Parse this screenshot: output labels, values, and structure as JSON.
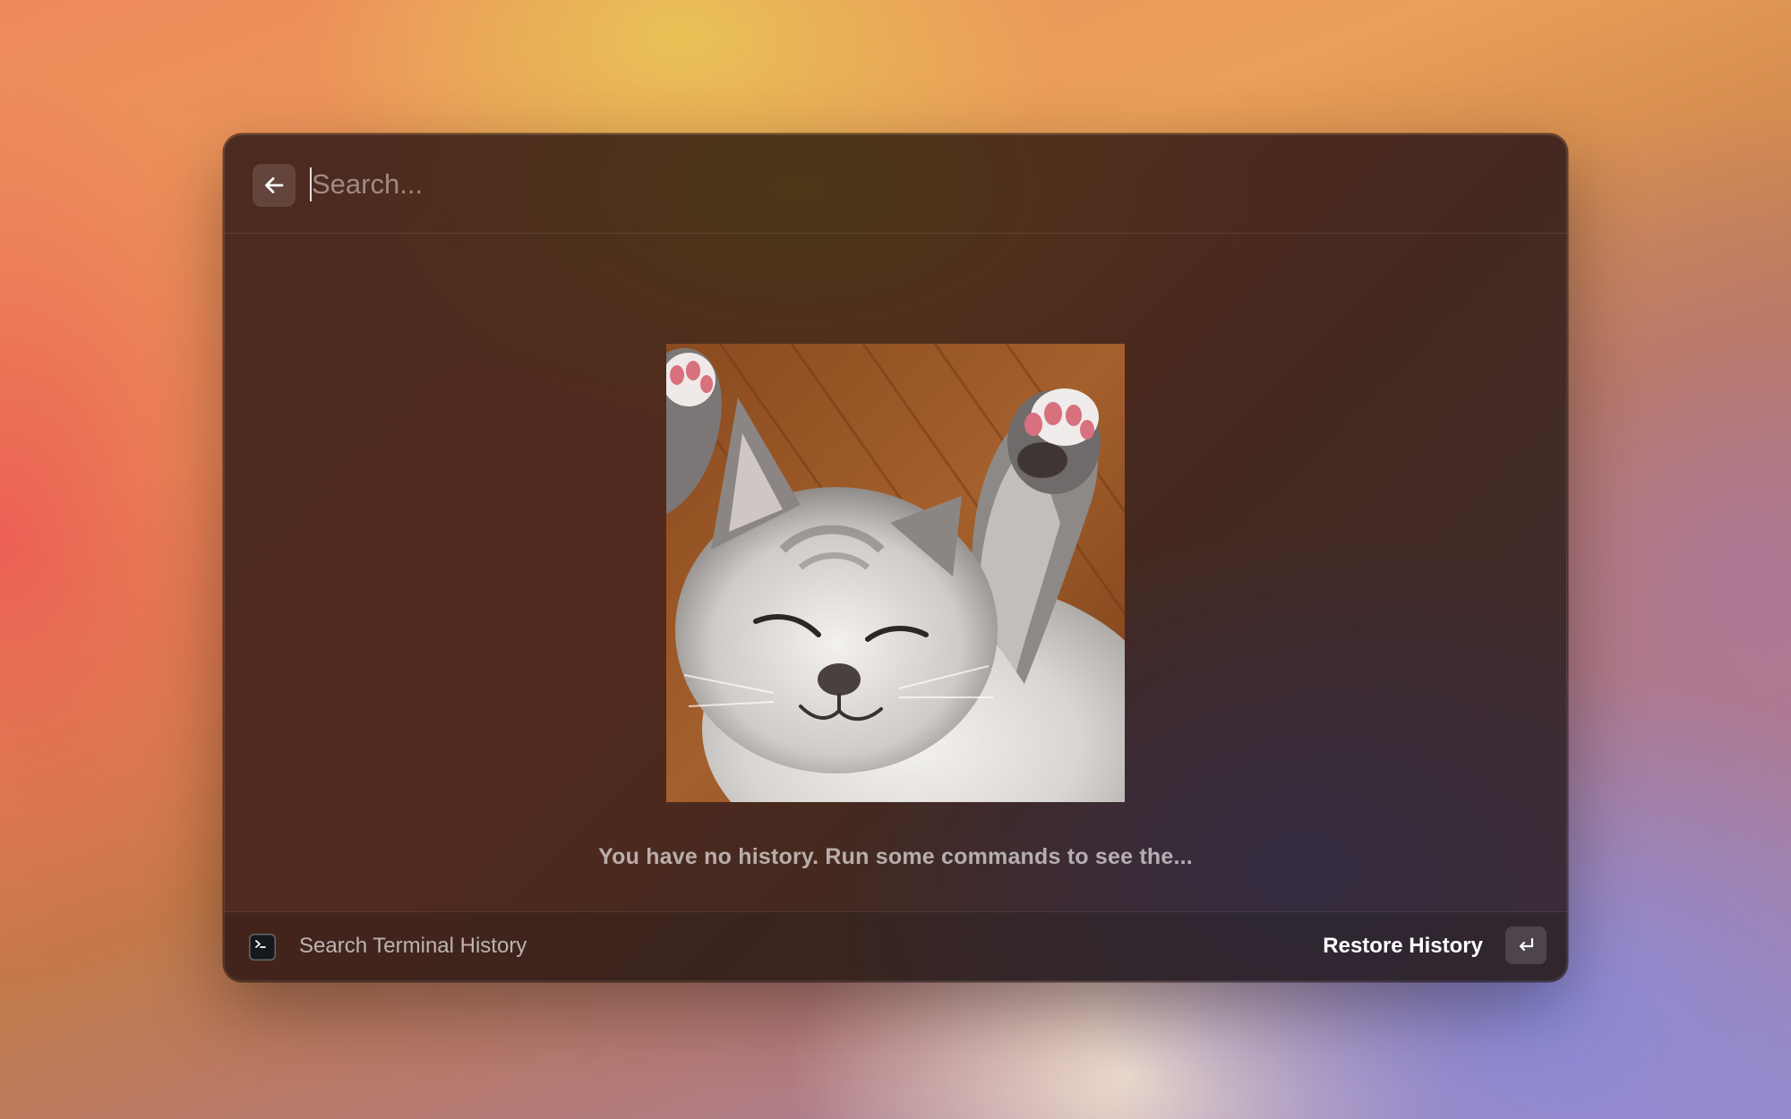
{
  "search": {
    "placeholder": "Search...",
    "value": ""
  },
  "empty_state": {
    "image": "sleeping-kitten",
    "message": "You have no history. Run some commands to see the..."
  },
  "action_bar": {
    "title": "Search Terminal History",
    "icon": "terminal-icon",
    "primary_action": "Restore History",
    "primary_shortcut_icon": "return-key-icon"
  },
  "colors": {
    "window_bg": "#4c2a20",
    "text_primary": "#ffffff",
    "text_muted": "#b7aaa5"
  }
}
